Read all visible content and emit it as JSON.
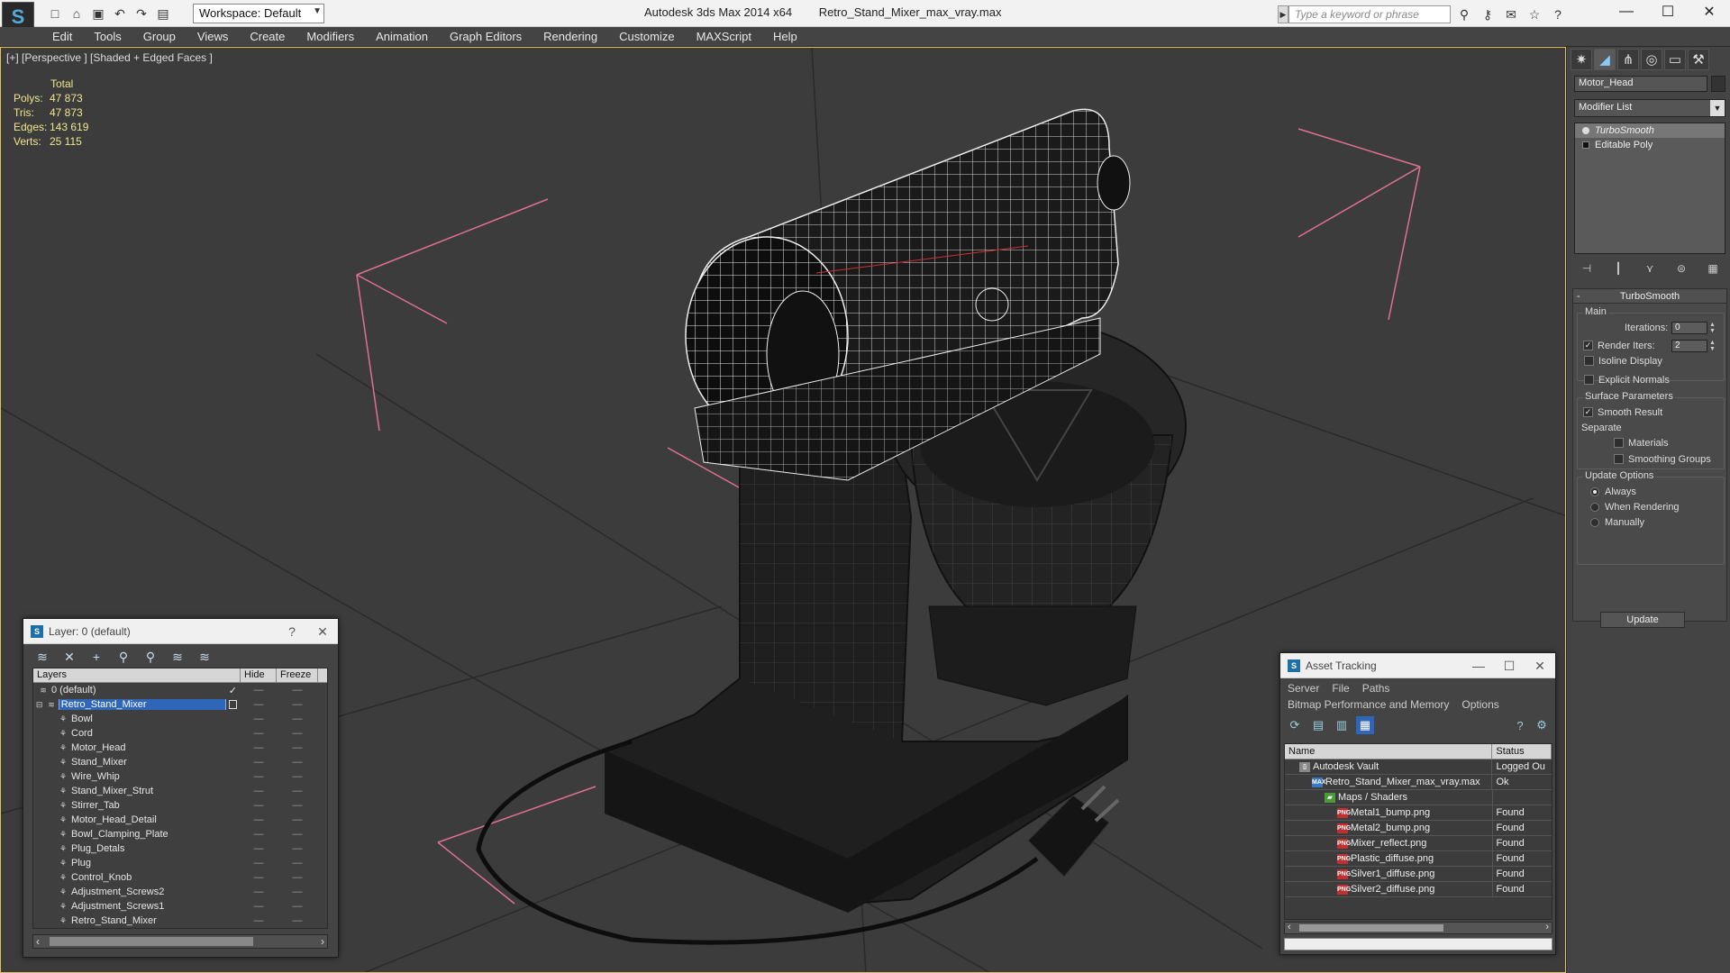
{
  "app": {
    "product": "Autodesk 3ds Max 2014 x64",
    "file": "Retro_Stand_Mixer_max_vray.max",
    "workspace": "Workspace: Default",
    "search_placeholder": "Type a keyword or phrase"
  },
  "menu": [
    "Edit",
    "Tools",
    "Group",
    "Views",
    "Create",
    "Modifiers",
    "Animation",
    "Graph Editors",
    "Rendering",
    "Customize",
    "MAXScript",
    "Help"
  ],
  "viewport": {
    "label": "[+] [Perspective ] [Shaded + Edged Faces ]",
    "stats": {
      "header": "Total",
      "rows": [
        {
          "k": "Polys:",
          "v": "47 873"
        },
        {
          "k": "Tris:",
          "v": "47 873"
        },
        {
          "k": "Edges:",
          "v": "143 619"
        },
        {
          "k": "Verts:",
          "v": "25 115"
        }
      ]
    }
  },
  "command_panel": {
    "object_name": "Motor_Head",
    "modifier_list": "Modifier List",
    "stack": [
      "TurboSmooth",
      "Editable Poly"
    ],
    "rollout": {
      "title": "TurboSmooth",
      "main": "Main",
      "iterations_label": "Iterations:",
      "iterations": "0",
      "render_iters_label": "Render Iters:",
      "render_iters": "2",
      "isoline": "Isoline Display",
      "explicit": "Explicit Normals",
      "surface": "Surface Parameters",
      "smooth": "Smooth Result",
      "separate": "Separate",
      "materials": "Materials",
      "smoothing_groups": "Smoothing Groups",
      "update_options": "Update Options",
      "always": "Always",
      "when_rendering": "When Rendering",
      "manually": "Manually",
      "update": "Update"
    }
  },
  "layer_dialog": {
    "title": "Layer: 0 (default)",
    "help": "?",
    "columns": [
      "Layers",
      "Hide",
      "Freeze"
    ],
    "rows": [
      {
        "name": "0 (default)",
        "level": 0,
        "check": "✓"
      },
      {
        "name": "Retro_Stand_Mixer",
        "level": 0,
        "selected": true
      },
      {
        "name": "Bowl",
        "level": 1
      },
      {
        "name": "Cord",
        "level": 1
      },
      {
        "name": "Motor_Head",
        "level": 1
      },
      {
        "name": "Stand_Mixer",
        "level": 1
      },
      {
        "name": "Wire_Whip",
        "level": 1
      },
      {
        "name": "Stand_Mixer_Strut",
        "level": 1
      },
      {
        "name": "Stirrer_Tab",
        "level": 1
      },
      {
        "name": "Motor_Head_Detail",
        "level": 1
      },
      {
        "name": "Bowl_Clamping_Plate",
        "level": 1
      },
      {
        "name": "Plug_Detals",
        "level": 1
      },
      {
        "name": "Plug",
        "level": 1
      },
      {
        "name": "Control_Knob",
        "level": 1
      },
      {
        "name": "Adjustment_Screws2",
        "level": 1
      },
      {
        "name": "Adjustment_Screws1",
        "level": 1
      },
      {
        "name": "Retro_Stand_Mixer",
        "level": 1
      }
    ]
  },
  "asset_dialog": {
    "title": "Asset Tracking",
    "menu1": [
      "Server",
      "File",
      "Paths"
    ],
    "menu2": [
      "Bitmap Performance and Memory",
      "Options"
    ],
    "columns": [
      "Name",
      "Status"
    ],
    "rows": [
      {
        "name": "Autodesk Vault",
        "status": "Logged Ou",
        "icon": "vault",
        "indent": 0
      },
      {
        "name": "Retro_Stand_Mixer_max_vray.max",
        "status": "Ok",
        "icon": "max",
        "indent": 1
      },
      {
        "name": "Maps / Shaders",
        "status": "",
        "icon": "fold",
        "indent": 2
      },
      {
        "name": "Metal1_bump.png",
        "status": "Found",
        "icon": "png",
        "indent": 3
      },
      {
        "name": "Metal2_bump.png",
        "status": "Found",
        "icon": "png",
        "indent": 3
      },
      {
        "name": "Mixer_reflect.png",
        "status": "Found",
        "icon": "png",
        "indent": 3
      },
      {
        "name": "Plastic_diffuse.png",
        "status": "Found",
        "icon": "png",
        "indent": 3
      },
      {
        "name": "Silver1_diffuse.png",
        "status": "Found",
        "icon": "png",
        "indent": 3
      },
      {
        "name": "Silver2_diffuse.png",
        "status": "Found",
        "icon": "png",
        "indent": 3
      }
    ]
  }
}
